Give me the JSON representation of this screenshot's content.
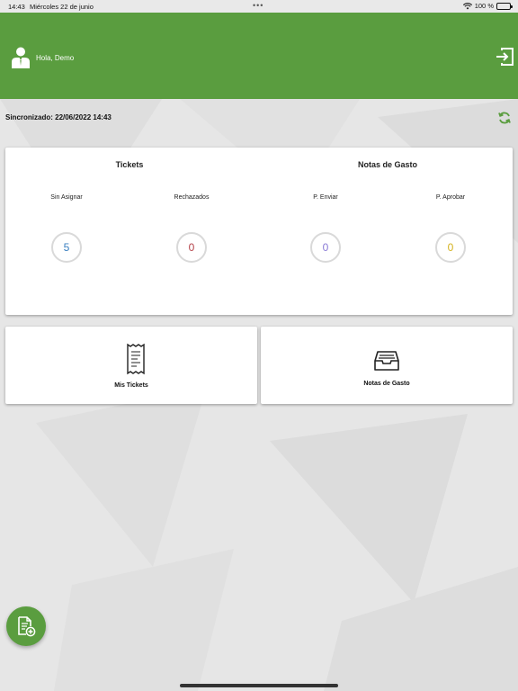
{
  "status_bar": {
    "time": "14:43",
    "date": "Miércoles 22 de junio",
    "battery_text": "100 %"
  },
  "header": {
    "greeting": "Hola, Demo",
    "background_color": "#5a9d3f"
  },
  "sync": {
    "label": "Sincronizado: 22/06/2022 14:43"
  },
  "stats": {
    "tickets_title": "Tickets",
    "notas_title": "Notas de Gasto",
    "items": [
      {
        "label": "Sin Asignar",
        "value": "5",
        "color": "#3a7fc0"
      },
      {
        "label": "Rechazados",
        "value": "0",
        "color": "#b5434a"
      },
      {
        "label": "P. Enviar",
        "value": "0",
        "color": "#8a7ad6"
      },
      {
        "label": "P. Aprobar",
        "value": "0",
        "color": "#d4b21f"
      }
    ]
  },
  "nav": {
    "tickets_label": "Mis Tickets",
    "notas_label": "Notas de Gasto"
  },
  "icons": {
    "user": "user-icon",
    "logout": "logout-icon",
    "refresh": "refresh-icon",
    "receipt": "receipt-icon",
    "inbox": "inbox-tray-icon",
    "new_document": "new-document-icon"
  }
}
